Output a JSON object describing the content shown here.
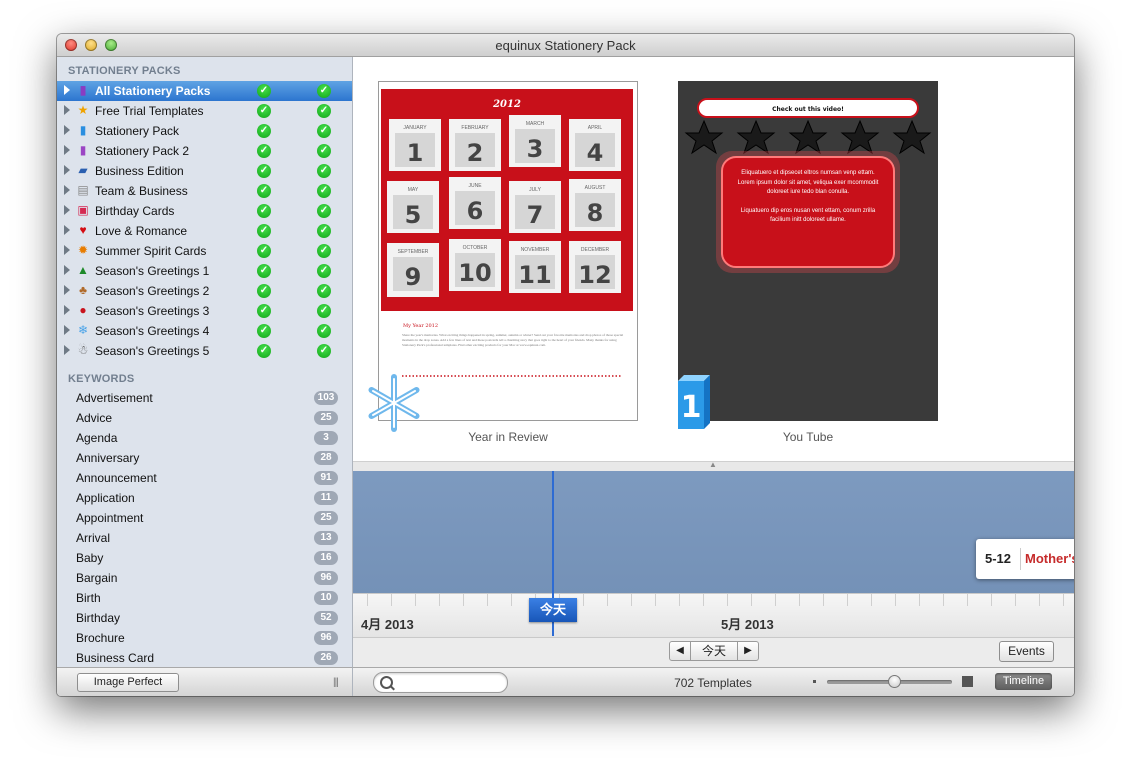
{
  "window": {
    "title": "equinux Stationery Pack"
  },
  "sidebar": {
    "packs_header": "STATIONERY PACKS",
    "packs": [
      {
        "label": "All Stationery Packs",
        "icon": "purple-book-icon",
        "selected": true
      },
      {
        "label": "Free Trial Templates",
        "icon": "star-icon"
      },
      {
        "label": "Stationery Pack",
        "icon": "blue-book-icon"
      },
      {
        "label": "Stationery Pack 2",
        "icon": "purple-book-icon"
      },
      {
        "label": "Business Edition",
        "icon": "business-book-icon"
      },
      {
        "label": "Team & Business",
        "icon": "notepad-icon"
      },
      {
        "label": "Birthday Cards",
        "icon": "gift-icon"
      },
      {
        "label": "Love & Romance",
        "icon": "heart-icon"
      },
      {
        "label": "Summer Spirit Cards",
        "icon": "sun-icon"
      },
      {
        "label": "Season's Greetings 1",
        "icon": "tree-icon"
      },
      {
        "label": "Season's Greetings 2",
        "icon": "gingerbread-icon"
      },
      {
        "label": "Season's Greetings 3",
        "icon": "ornament-icon"
      },
      {
        "label": "Season's Greetings 4",
        "icon": "snowflake-icon"
      },
      {
        "label": "Season's Greetings 5",
        "icon": "snowman-icon"
      }
    ],
    "keywords_header": "KEYWORDS",
    "keywords": [
      {
        "label": "Advertisement",
        "count": "103"
      },
      {
        "label": "Advice",
        "count": "25"
      },
      {
        "label": "Agenda",
        "count": "3"
      },
      {
        "label": "Anniversary",
        "count": "28"
      },
      {
        "label": "Announcement",
        "count": "91"
      },
      {
        "label": "Application",
        "count": "11"
      },
      {
        "label": "Appointment",
        "count": "25"
      },
      {
        "label": "Arrival",
        "count": "13"
      },
      {
        "label": "Baby",
        "count": "16"
      },
      {
        "label": "Bargain",
        "count": "96"
      },
      {
        "label": "Birth",
        "count": "10"
      },
      {
        "label": "Birthday",
        "count": "52"
      },
      {
        "label": "Brochure",
        "count": "96"
      },
      {
        "label": "Business Card",
        "count": "26"
      }
    ],
    "image_perfect_label": "Image Perfect",
    "grip_label": "|||"
  },
  "templates": [
    {
      "caption": "Year in Review",
      "year": "2012",
      "months": [
        "JANUARY",
        "FEBRUARY",
        "MARCH",
        "APRIL",
        "MAY",
        "JUNE",
        "JULY",
        "AUGUST",
        "SEPTEMBER",
        "OCTOBER",
        "NOVEMBER",
        "DECEMBER"
      ],
      "numbers": [
        "1",
        "2",
        "3",
        "4",
        "5",
        "6",
        "7",
        "8",
        "9",
        "10",
        "11",
        "12"
      ],
      "subheading": "My Year 2012",
      "body_text": "Share the year's memories. What exciting things happened in spring, summer, autumn or winter? Send out your favorite memories and drop photos of those special moments in the drop zones. Add a few lines of text and these postcards tell a charming story that goes right to the heart of your friends. Many thanks for using Stationery Pack's professional templates. Find other exciting products for your Mac at www.equinux.com.",
      "badge_icon": "snowflake-icon"
    },
    {
      "caption": "You Tube",
      "header_text": "Check out this video!",
      "paragraph1": "Eliquatuero et dipsecet eltros numsan venp ettam. Lorem ipsum dolor sit amet, veliqua exer mcommodit doloreet iure tedo blan conulla.",
      "paragraph2": "Liquatuero dip eros nusan vent ettam, conum zrilla facilium initt doloreet ullame.",
      "badge_text": "1",
      "badge_icon": "blue-number-one-icon"
    }
  ],
  "timeline": {
    "months": [
      "4月 2013",
      "5月 2013"
    ],
    "today_label": "今天",
    "event": {
      "date": "5-12",
      "name": "Mother's Day"
    }
  },
  "navigation": {
    "prev_icon": "◀",
    "today_label": "今天",
    "next_icon": "▶",
    "events_label": "Events"
  },
  "bottom": {
    "search_placeholder": "",
    "count_text": "702 Templates",
    "view_mode_label": "Timeline"
  },
  "colors": {
    "selection": "#2c75cf",
    "timeline_bg": "#7896bd",
    "today_blue": "#1856b8",
    "check_green": "#12a51a",
    "calendar_red": "#c8101a"
  }
}
